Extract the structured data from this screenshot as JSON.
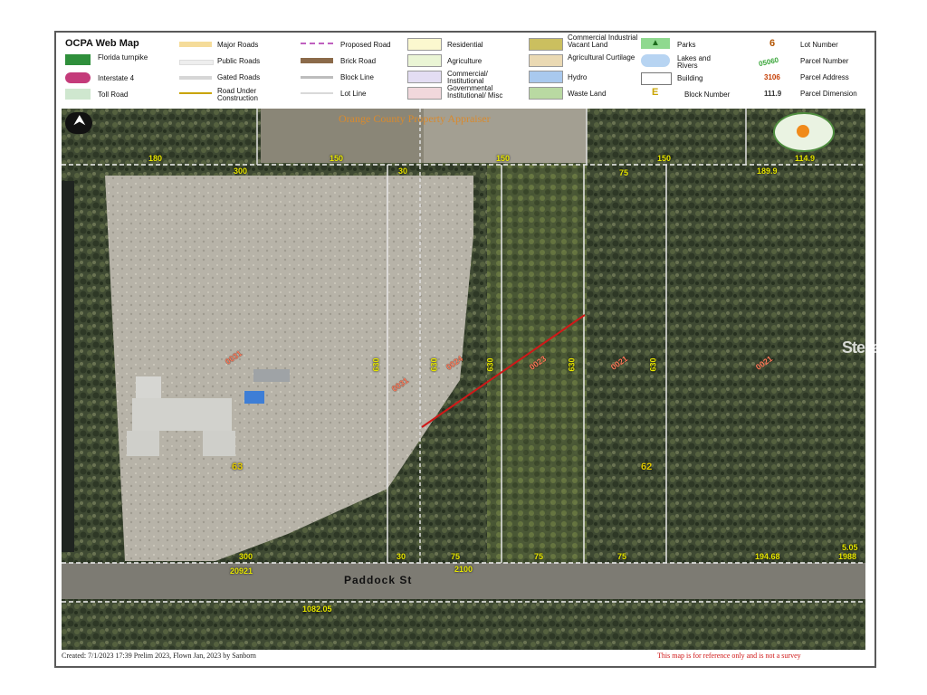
{
  "legend": {
    "title": "OCPA Web Map",
    "items": [
      {
        "label": "Florida turnpike"
      },
      {
        "label": "Interstate 4"
      },
      {
        "label": "Toll Road"
      },
      {
        "label": "Major Roads"
      },
      {
        "label": "Public Roads"
      },
      {
        "label": "Gated Roads"
      },
      {
        "label": "Road Under Construction"
      },
      {
        "label": "Proposed Road"
      },
      {
        "label": "Brick Road"
      },
      {
        "label": "Block Line"
      },
      {
        "label": "Lot Line"
      },
      {
        "label": "Residential"
      },
      {
        "label": "Agriculture"
      },
      {
        "label": "Commercial/ Institutional"
      },
      {
        "label": "Governmental Institutional/ Misc"
      },
      {
        "label": "Commercial Industrial Vacant Land"
      },
      {
        "label": "Agricultural Curtilage"
      },
      {
        "label": "Hydro"
      },
      {
        "label": "Waste Land"
      },
      {
        "label": "Parks"
      },
      {
        "label": "Lakes and Rivers"
      },
      {
        "label": "Building"
      },
      {
        "label": "Block Number"
      },
      {
        "label": "Lot Number"
      },
      {
        "label": "Parcel Number"
      },
      {
        "label": "Parcel Address"
      },
      {
        "label": "Parcel Dimension"
      }
    ],
    "samples": {
      "lot_number": "6",
      "parcel_number": "05060",
      "parcel_address": "3106",
      "parcel_dimension": "111.9",
      "block_number": "E"
    }
  },
  "map": {
    "header_text": "Orange County Property Appraiser",
    "street_name": "Paddock St",
    "top_dims": [
      "180",
      "300",
      "150",
      "30",
      "150",
      "75",
      "150",
      "189.9",
      "114.9"
    ],
    "bottom_dims": [
      "300",
      "30",
      "75",
      "75",
      "75",
      "194.68",
      "5.05",
      "1988"
    ],
    "side_dims": [
      "630",
      "630",
      "630",
      "630",
      "630"
    ],
    "address_numbers": [
      "20921",
      "2100",
      "1082.05"
    ],
    "block_numbers": [
      "63",
      "62"
    ],
    "parcel_labels": [
      "0031",
      "0031",
      "0024",
      "0023",
      "0021",
      "0021"
    ]
  },
  "footer": {
    "created": "Created: 7/1/2023 17:39   Prelim 2023, Flown Jan, 2023 by Sanborn",
    "disclaimer": "This map is for reference only and is not a survey"
  },
  "watermark": "StellarMLS"
}
